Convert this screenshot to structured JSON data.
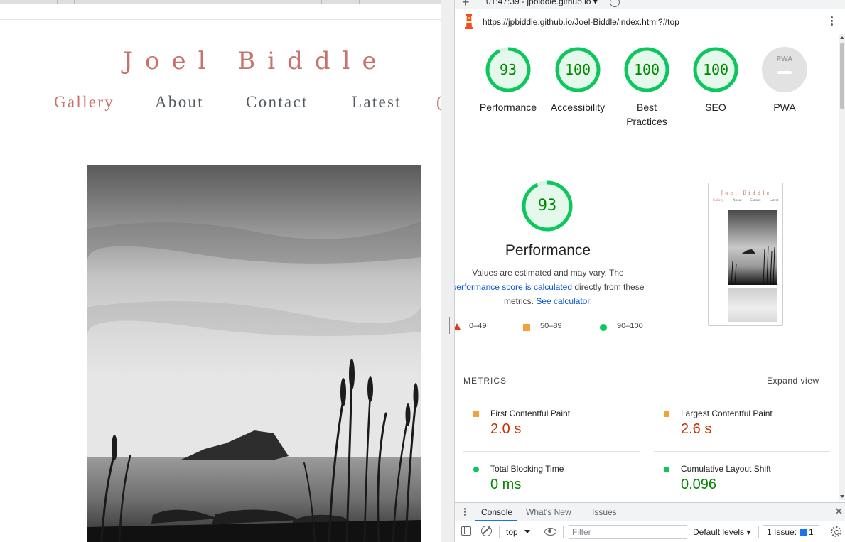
{
  "site": {
    "brand": "Joel Biddle",
    "nav": [
      "Gallery",
      "About",
      "Contact",
      "Latest"
    ],
    "active_nav": "Gallery",
    "partial_nav_glyph": "("
  },
  "devtools": {
    "run_label": "01:47:39 - jpbiddle.github.io",
    "url": "https://jpbiddle.github.io/Joel-Biddle/index.html?#top",
    "categories": [
      {
        "label": "Performance",
        "score": "93",
        "fraction": 0.93
      },
      {
        "label": "Accessibility",
        "score": "100",
        "fraction": 1.0
      },
      {
        "label": "Best Practices",
        "score": "100",
        "fraction": 1.0
      },
      {
        "label": "SEO",
        "score": "100",
        "fraction": 1.0
      },
      {
        "label": "PWA",
        "badge": "PWA"
      }
    ],
    "performance": {
      "score": "93",
      "fraction": 0.93,
      "title": "Performance",
      "note_1": "Values are estimated and may vary. The",
      "note_link_1": "performance score is calculated",
      "note_2": "directly from these metrics.",
      "note_link_2": "See calculator.",
      "legend": [
        "0–49",
        "50–89",
        "90–100"
      ]
    },
    "screenshot": {
      "brand": "Joel Biddle",
      "nav": [
        "Gallery",
        "About",
        "Contact",
        "Latest"
      ]
    },
    "metrics": {
      "header": "METRICS",
      "expand": "Expand view",
      "items": [
        {
          "name": "First Contentful Paint",
          "value": "2.0 s",
          "status": "average"
        },
        {
          "name": "Largest Contentful Paint",
          "value": "2.6 s",
          "status": "average"
        },
        {
          "name": "Total Blocking Time",
          "value": "0 ms",
          "status": "pass"
        },
        {
          "name": "Cumulative Layout Shift",
          "value": "0.096",
          "status": "pass"
        }
      ]
    },
    "drawer": {
      "tabs": [
        "Console",
        "What's New",
        "Issues"
      ],
      "active_tab": "Console",
      "context": "top",
      "filter_placeholder": "Filter",
      "levels": "Default levels",
      "issues_label": "1 Issue:",
      "issues_count": "1"
    }
  },
  "colors": {
    "brand_pink": "#c9716b",
    "pass_green": "#0cc85c",
    "pass_text": "#008800",
    "average_orange": "#f5a03a",
    "fail_red": "#e0371d",
    "link_blue": "#0b57d0"
  }
}
